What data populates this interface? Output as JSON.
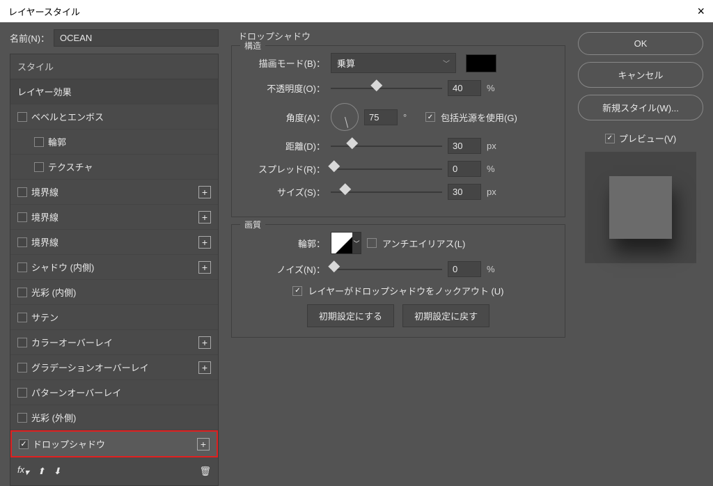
{
  "titlebar": {
    "title": "レイヤースタイル"
  },
  "name": {
    "label": "名前(N)：",
    "value": "OCEAN"
  },
  "sidebar": {
    "header": "スタイル",
    "layerFx": "レイヤー効果",
    "items": [
      {
        "label": "ベベルとエンボス",
        "checked": false,
        "plus": false
      },
      {
        "label": "輪郭",
        "checked": false,
        "plus": false,
        "indent": true
      },
      {
        "label": "テクスチャ",
        "checked": false,
        "plus": false,
        "indent": true
      },
      {
        "label": "境界線",
        "checked": false,
        "plus": true
      },
      {
        "label": "境界線",
        "checked": false,
        "plus": true
      },
      {
        "label": "境界線",
        "checked": false,
        "plus": true
      },
      {
        "label": "シャドウ (内側)",
        "checked": false,
        "plus": true
      },
      {
        "label": "光彩 (内側)",
        "checked": false,
        "plus": false
      },
      {
        "label": "サテン",
        "checked": false,
        "plus": false
      },
      {
        "label": "カラーオーバーレイ",
        "checked": false,
        "plus": true
      },
      {
        "label": "グラデーションオーバーレイ",
        "checked": false,
        "plus": true
      },
      {
        "label": "パターンオーバーレイ",
        "checked": false,
        "plus": false
      },
      {
        "label": "光彩 (外側)",
        "checked": false,
        "plus": false
      },
      {
        "label": "ドロップシャドウ",
        "checked": true,
        "plus": true,
        "highlighted": true
      }
    ],
    "footer": {
      "fx": "fx"
    }
  },
  "panel": {
    "title": "ドロップシャドウ",
    "structure": {
      "legend": "構造",
      "blendMode": {
        "label": "描画モード(B)：",
        "value": "乗算"
      },
      "opacity": {
        "label": "不透明度(O)：",
        "value": "40",
        "unit": "%"
      },
      "angle": {
        "label": "角度(A)：",
        "value": "75",
        "unit": "°",
        "globalLabel": "包括光源を使用(G)",
        "globalChecked": true
      },
      "distance": {
        "label": "距離(D)：",
        "value": "30",
        "unit": "px"
      },
      "spread": {
        "label": "スプレッド(R)：",
        "value": "0",
        "unit": "%"
      },
      "size": {
        "label": "サイズ(S)：",
        "value": "30",
        "unit": "px"
      }
    },
    "quality": {
      "legend": "画質",
      "contourLabel": "輪郭：",
      "antialias": {
        "label": "アンチエイリアス(L)",
        "checked": false
      },
      "noise": {
        "label": "ノイズ(N)：",
        "value": "0",
        "unit": "%"
      },
      "knockout": {
        "label": "レイヤーがドロップシャドウをノックアウト (U)",
        "checked": true
      }
    },
    "buttons": {
      "makeDefault": "初期設定にする",
      "resetDefault": "初期設定に戻す"
    }
  },
  "right": {
    "ok": "OK",
    "cancel": "キャンセル",
    "newStyle": "新規スタイル(W)...",
    "previewLabel": "プレビュー(V)",
    "previewChecked": true
  }
}
